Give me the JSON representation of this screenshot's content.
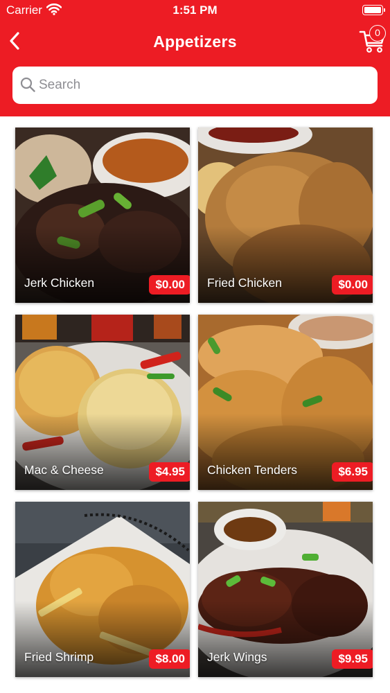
{
  "status_bar": {
    "carrier": "Carrier",
    "time": "1:51 PM"
  },
  "nav": {
    "title": "Appetizers",
    "cart_count": "0"
  },
  "search": {
    "placeholder": "Search",
    "value": ""
  },
  "colors": {
    "brand_red": "#ed1c24",
    "text_light": "#ffffff",
    "placeholder": "#8e8e93"
  },
  "icons": {
    "back": "chevron-left-icon",
    "cart": "cart-icon",
    "search": "search-icon",
    "wifi": "wifi-icon",
    "battery": "battery-icon"
  },
  "items": [
    {
      "name": "Jerk Chicken",
      "price": "$0.00"
    },
    {
      "name": "Fried Chicken",
      "price": "$0.00"
    },
    {
      "name": "Mac & Cheese",
      "price": "$4.95"
    },
    {
      "name": "Chicken Tenders",
      "price": "$6.95"
    },
    {
      "name": "Fried Shrimp",
      "price": "$8.00"
    },
    {
      "name": "Jerk Wings",
      "price": "$9.95"
    }
  ]
}
